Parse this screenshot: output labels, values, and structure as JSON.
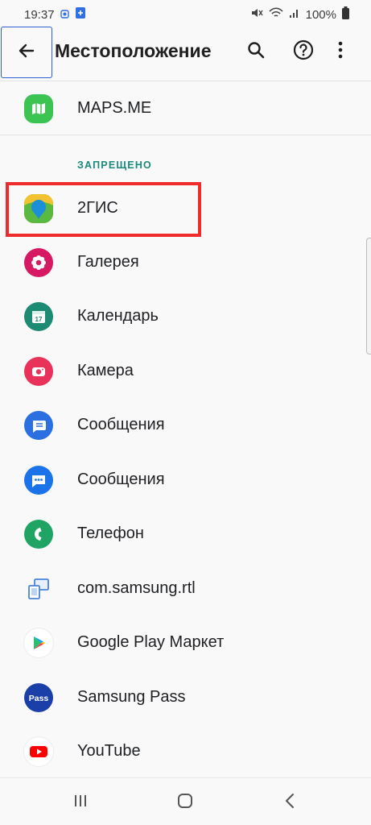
{
  "status_bar": {
    "time": "19:37",
    "battery": "100%",
    "icons": [
      "notification-icon",
      "screen-share-icon",
      "mute-icon",
      "wifi-icon",
      "signal-icon",
      "battery-icon"
    ]
  },
  "app_bar": {
    "title": "Местоположение",
    "back_icon": "arrow-back-icon",
    "actions": [
      "search-icon",
      "help-icon",
      "more-vert-icon"
    ]
  },
  "list": {
    "top_item": {
      "label": "MAPS.ME",
      "icon": "mapsme-icon",
      "color": "#3cc453"
    },
    "section_header": "ЗАПРЕЩЕНО",
    "items": [
      {
        "label": "2ГИС",
        "icon": "2gis-icon",
        "color": "#59b941"
      },
      {
        "label": "Галерея",
        "icon": "gallery-icon",
        "color": "#d71862"
      },
      {
        "label": "Календарь",
        "icon": "calendar-icon",
        "color": "#1d8a73"
      },
      {
        "label": "Камера",
        "icon": "camera-icon",
        "color": "#e8325a"
      },
      {
        "label": "Сообщения",
        "icon": "messages-icon",
        "color": "#2c6fe0"
      },
      {
        "label": "Сообщения",
        "icon": "messages-google-icon",
        "color": "#1a73e8"
      },
      {
        "label": "Телефон",
        "icon": "phone-icon",
        "color": "#1fa463"
      },
      {
        "label": "com.samsung.rtl",
        "icon": "rtl-icon",
        "color": "#4a84d8"
      },
      {
        "label": "Google Play Маркет",
        "icon": "play-store-icon",
        "color": "#ffffff"
      },
      {
        "label": "Samsung Pass",
        "icon": "samsung-pass-icon",
        "color": "#1b3fa8"
      },
      {
        "label": "YouTube",
        "icon": "youtube-icon",
        "color": "#ff0000"
      }
    ]
  },
  "nav_bar": {
    "icons": [
      "recents-icon",
      "home-icon",
      "back-nav-icon"
    ]
  },
  "colors": {
    "accent": "#1a8a7a",
    "highlight": "#ef2b2b",
    "focus": "#2f5fd0"
  }
}
